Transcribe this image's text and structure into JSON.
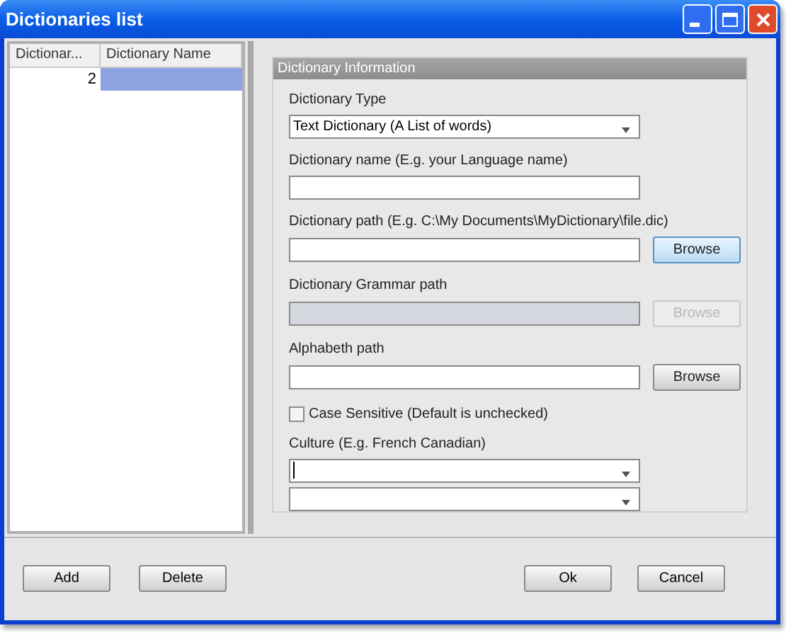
{
  "window": {
    "title": "Dictionaries list"
  },
  "table": {
    "columns": [
      "Dictionar...",
      "Dictionary Name"
    ],
    "rows": [
      {
        "cells": [
          "2",
          ""
        ],
        "selected": true
      }
    ]
  },
  "panel": {
    "title": "Dictionary Information",
    "fields": [
      {
        "kind": "combo",
        "label": "Dictionary Type",
        "value": "Text Dictionary (A List of words)"
      },
      {
        "kind": "text",
        "label": "Dictionary name (E.g. your Language name)"
      },
      {
        "kind": "path",
        "label": "Dictionary path (E.g. C:\\My Documents\\MyDictionary\\file.dic)",
        "button": "Browse",
        "disabled": false,
        "focused": true
      },
      {
        "kind": "path",
        "label": "Dictionary Grammar path",
        "button": "Browse",
        "disabled": true,
        "focused": false
      },
      {
        "kind": "path",
        "label": "Alphabeth path",
        "button": "Browse",
        "disabled": false,
        "focused": false
      },
      {
        "kind": "checkbox",
        "label": "Case Sensitive (Default is unchecked)",
        "checked": false
      },
      {
        "kind": "combo",
        "label": "Culture (E.g. French Canadian)",
        "caret": true
      },
      {
        "kind": "combo",
        "caret": false
      }
    ]
  },
  "buttons_left": [
    "Add",
    "Delete"
  ],
  "buttons_right": [
    "Ok",
    "Cancel"
  ]
}
